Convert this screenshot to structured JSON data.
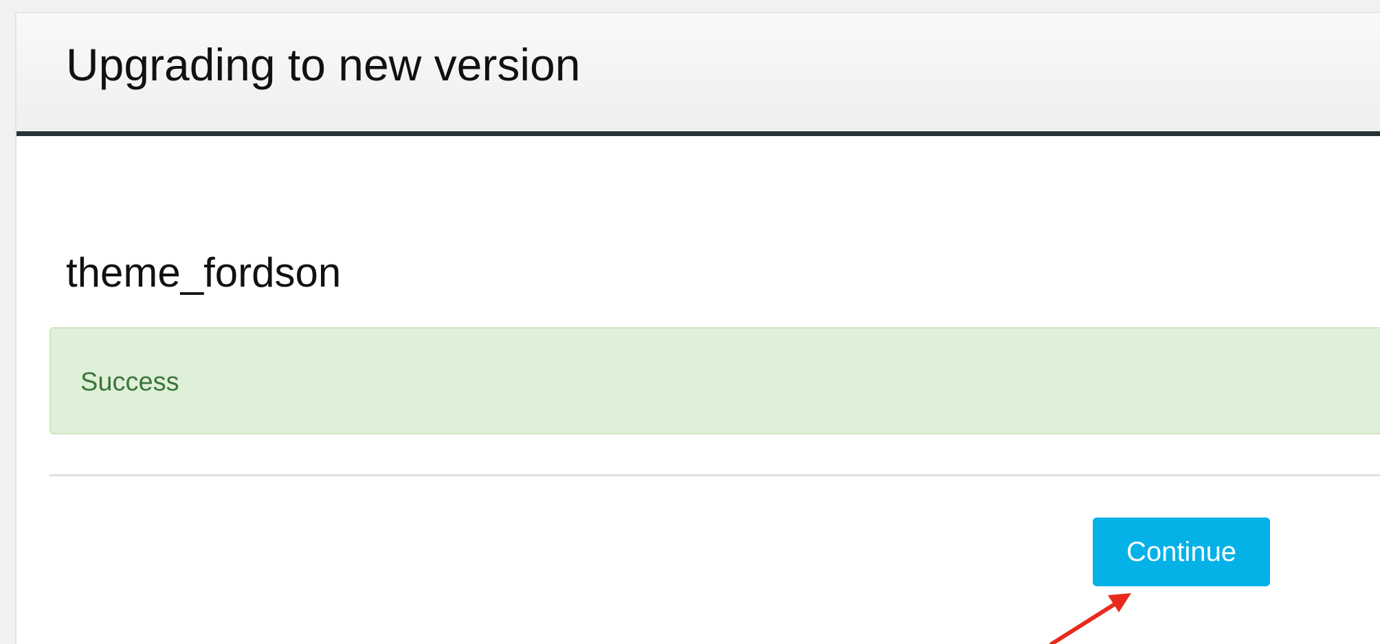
{
  "header": {
    "title": "Upgrading to new version"
  },
  "component": {
    "name": "theme_fordson"
  },
  "alert": {
    "message": "Success",
    "color": "#3c763d",
    "background": "#dff0d8"
  },
  "actions": {
    "continue_label": "Continue",
    "accent_color": "#04b2e8"
  },
  "annotation": {
    "icon": "red-arrow-icon",
    "color": "#e82a1d"
  }
}
